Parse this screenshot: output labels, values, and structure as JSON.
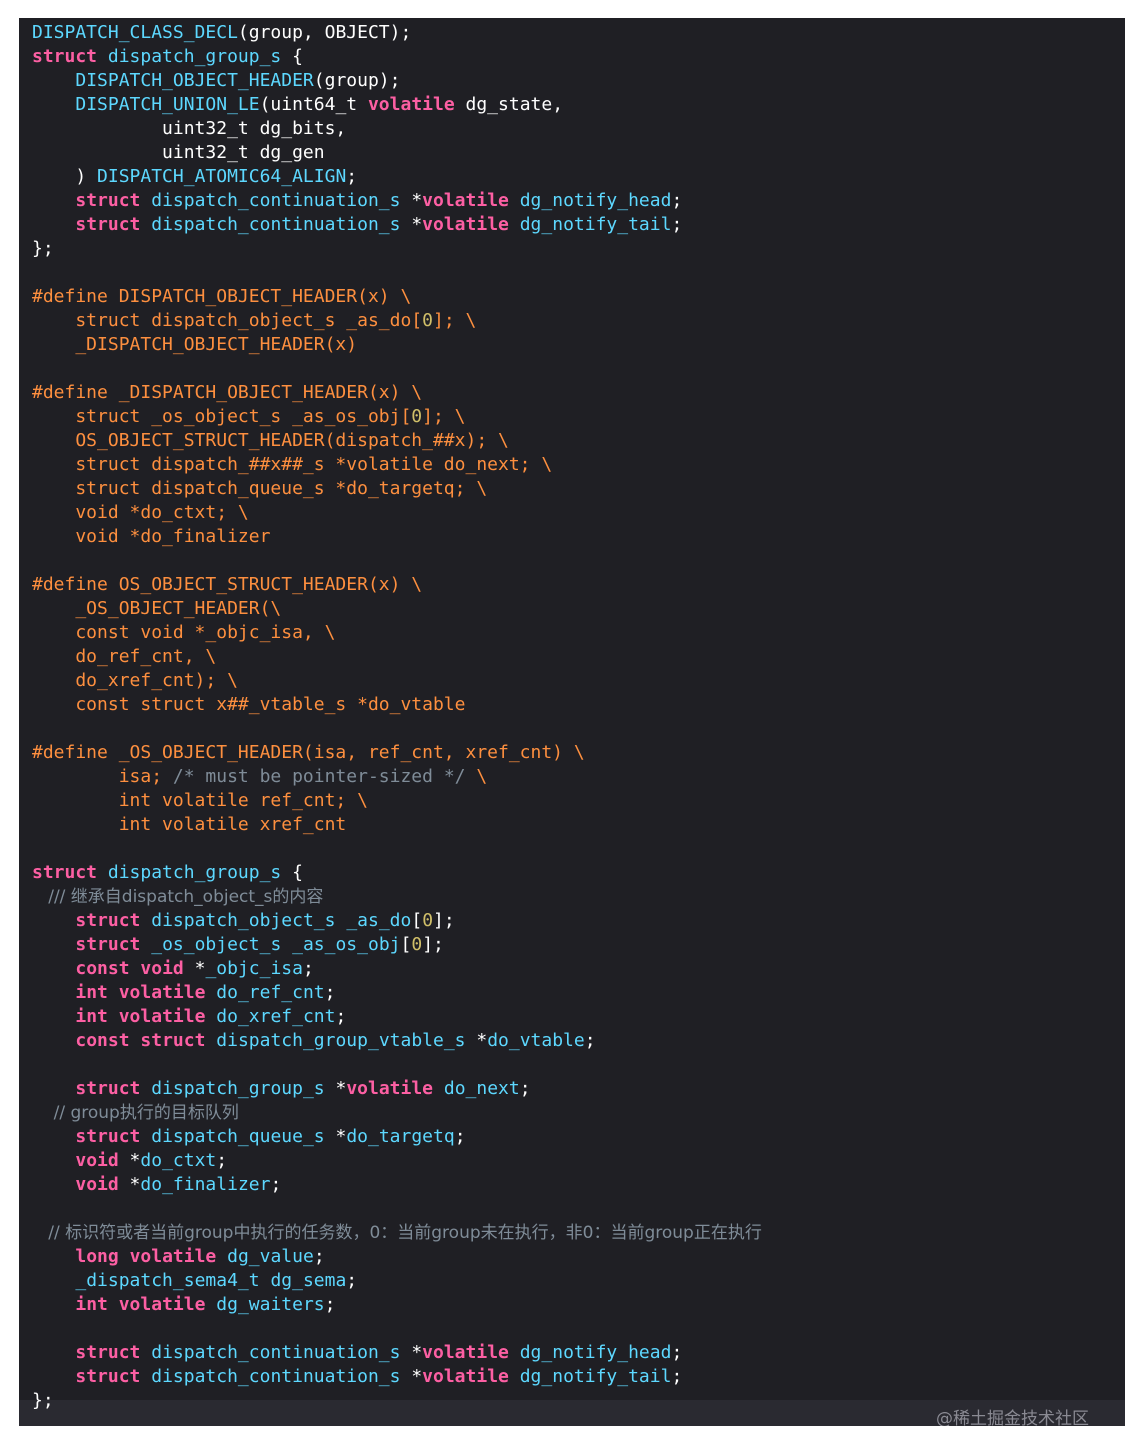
{
  "colors": {
    "background": "#1f1f24",
    "plain": "#ffffff",
    "keyword": "#fc5fa3",
    "type": "#5dd8ff",
    "macro": "#fd8f3f",
    "number": "#d0bf69",
    "comment": "#7f8c98"
  },
  "code_lines": [
    {
      "row": 0,
      "tokens": [
        [
          "DISPATCH_CLASS_DECL",
          "type"
        ],
        [
          "(group, OBJECT);",
          "plain"
        ]
      ]
    },
    {
      "row": 1,
      "tokens": [
        [
          "struct",
          "keyword"
        ],
        [
          " ",
          "plain"
        ],
        [
          "dispatch_group_s",
          "type"
        ],
        [
          " {",
          "plain"
        ]
      ]
    },
    {
      "row": 2,
      "tokens": [
        [
          "    ",
          "plain"
        ],
        [
          "DISPATCH_OBJECT_HEADER",
          "type"
        ],
        [
          "(group);",
          "plain"
        ]
      ]
    },
    {
      "row": 3,
      "tokens": [
        [
          "    ",
          "plain"
        ],
        [
          "DISPATCH_UNION_LE",
          "type"
        ],
        [
          "(uint64_t ",
          "plain"
        ],
        [
          "volatile",
          "keyword"
        ],
        [
          " dg_state,",
          "plain"
        ]
      ]
    },
    {
      "row": 4,
      "tokens": [
        [
          "            uint32_t dg_bits,",
          "plain"
        ]
      ]
    },
    {
      "row": 5,
      "tokens": [
        [
          "            uint32_t dg_gen",
          "plain"
        ]
      ]
    },
    {
      "row": 6,
      "tokens": [
        [
          "    ) ",
          "plain"
        ],
        [
          "DISPATCH_ATOMIC64_ALIGN",
          "type"
        ],
        [
          ";",
          "plain"
        ]
      ]
    },
    {
      "row": 7,
      "tokens": [
        [
          "    ",
          "plain"
        ],
        [
          "struct",
          "keyword"
        ],
        [
          " ",
          "plain"
        ],
        [
          "dispatch_continuation_s",
          "type"
        ],
        [
          " *",
          "plain"
        ],
        [
          "volatile",
          "keyword"
        ],
        [
          " ",
          "plain"
        ],
        [
          "dg_notify_head",
          "type"
        ],
        [
          ";",
          "plain"
        ]
      ]
    },
    {
      "row": 8,
      "tokens": [
        [
          "    ",
          "plain"
        ],
        [
          "struct",
          "keyword"
        ],
        [
          " ",
          "plain"
        ],
        [
          "dispatch_continuation_s",
          "type"
        ],
        [
          " *",
          "plain"
        ],
        [
          "volatile",
          "keyword"
        ],
        [
          " ",
          "plain"
        ],
        [
          "dg_notify_tail",
          "type"
        ],
        [
          ";",
          "plain"
        ]
      ]
    },
    {
      "row": 9,
      "tokens": [
        [
          "};",
          "plain"
        ]
      ]
    },
    {
      "row": 11,
      "tokens": [
        [
          "#define DISPATCH_OBJECT_HEADER(x) \\",
          "macro"
        ]
      ]
    },
    {
      "row": 12,
      "tokens": [
        [
          "    struct dispatch_object_s _as_do[",
          "macro"
        ],
        [
          "0",
          "number"
        ],
        [
          "]; \\",
          "macro"
        ]
      ]
    },
    {
      "row": 13,
      "tokens": [
        [
          "    _DISPATCH_OBJECT_HEADER(x)",
          "macro"
        ]
      ]
    },
    {
      "row": 15,
      "tokens": [
        [
          "#define _DISPATCH_OBJECT_HEADER(x) \\",
          "macro"
        ]
      ]
    },
    {
      "row": 16,
      "tokens": [
        [
          "    struct _os_object_s _as_os_obj[",
          "macro"
        ],
        [
          "0",
          "number"
        ],
        [
          "]; \\",
          "macro"
        ]
      ]
    },
    {
      "row": 17,
      "tokens": [
        [
          "    OS_OBJECT_STRUCT_HEADER(dispatch_##x); \\",
          "macro"
        ]
      ]
    },
    {
      "row": 18,
      "tokens": [
        [
          "    struct dispatch_##x##_s *volatile do_next; \\",
          "macro"
        ]
      ]
    },
    {
      "row": 19,
      "tokens": [
        [
          "    struct dispatch_queue_s *do_targetq; \\",
          "macro"
        ]
      ]
    },
    {
      "row": 20,
      "tokens": [
        [
          "    void *do_ctxt; \\",
          "macro"
        ]
      ]
    },
    {
      "row": 21,
      "tokens": [
        [
          "    void *do_finalizer",
          "macro"
        ]
      ]
    },
    {
      "row": 23,
      "tokens": [
        [
          "#define OS_OBJECT_STRUCT_HEADER(x) \\",
          "macro"
        ]
      ]
    },
    {
      "row": 24,
      "tokens": [
        [
          "    _OS_OBJECT_HEADER(\\",
          "macro"
        ]
      ]
    },
    {
      "row": 25,
      "tokens": [
        [
          "    const void *_objc_isa, \\",
          "macro"
        ]
      ]
    },
    {
      "row": 26,
      "tokens": [
        [
          "    do_ref_cnt, \\",
          "macro"
        ]
      ]
    },
    {
      "row": 27,
      "tokens": [
        [
          "    do_xref_cnt); \\",
          "macro"
        ]
      ]
    },
    {
      "row": 28,
      "tokens": [
        [
          "    const struct x##_vtable_s *do_vtable",
          "macro"
        ]
      ]
    },
    {
      "row": 30,
      "tokens": [
        [
          "#define _OS_OBJECT_HEADER(isa, ref_cnt, xref_cnt) \\",
          "macro"
        ]
      ]
    },
    {
      "row": 31,
      "tokens": [
        [
          "        isa; ",
          "macro"
        ],
        [
          "/* must be pointer-sized */",
          "comment"
        ],
        [
          " \\",
          "macro"
        ]
      ]
    },
    {
      "row": 32,
      "tokens": [
        [
          "        int volatile ref_cnt; \\",
          "macro"
        ]
      ]
    },
    {
      "row": 33,
      "tokens": [
        [
          "        int volatile xref_cnt",
          "macro"
        ]
      ]
    },
    {
      "row": 35,
      "tokens": [
        [
          "struct",
          "keyword"
        ],
        [
          " ",
          "plain"
        ],
        [
          "dispatch_group_s",
          "type"
        ],
        [
          " {",
          "plain"
        ]
      ]
    },
    {
      "row": 36,
      "tokens": [
        [
          "   /// 继承自dispatch_object_s的内容",
          "comment"
        ]
      ]
    },
    {
      "row": 37,
      "tokens": [
        [
          "    ",
          "plain"
        ],
        [
          "struct",
          "keyword"
        ],
        [
          " ",
          "plain"
        ],
        [
          "dispatch_object_s",
          "type"
        ],
        [
          " ",
          "plain"
        ],
        [
          "_as_do",
          "type"
        ],
        [
          "[",
          "plain"
        ],
        [
          "0",
          "number"
        ],
        [
          "];",
          "plain"
        ]
      ]
    },
    {
      "row": 38,
      "tokens": [
        [
          "    ",
          "plain"
        ],
        [
          "struct",
          "keyword"
        ],
        [
          " ",
          "plain"
        ],
        [
          "_os_object_s",
          "type"
        ],
        [
          " ",
          "plain"
        ],
        [
          "_as_os_obj",
          "type"
        ],
        [
          "[",
          "plain"
        ],
        [
          "0",
          "number"
        ],
        [
          "];",
          "plain"
        ]
      ]
    },
    {
      "row": 39,
      "tokens": [
        [
          "    ",
          "plain"
        ],
        [
          "const",
          "keyword"
        ],
        [
          " ",
          "plain"
        ],
        [
          "void",
          "keyword"
        ],
        [
          " *",
          "plain"
        ],
        [
          "_objc_isa",
          "type"
        ],
        [
          ";",
          "plain"
        ]
      ]
    },
    {
      "row": 40,
      "tokens": [
        [
          "    ",
          "plain"
        ],
        [
          "int",
          "keyword"
        ],
        [
          " ",
          "plain"
        ],
        [
          "volatile",
          "keyword"
        ],
        [
          " ",
          "plain"
        ],
        [
          "do_ref_cnt",
          "type"
        ],
        [
          ";",
          "plain"
        ]
      ]
    },
    {
      "row": 41,
      "tokens": [
        [
          "    ",
          "plain"
        ],
        [
          "int",
          "keyword"
        ],
        [
          " ",
          "plain"
        ],
        [
          "volatile",
          "keyword"
        ],
        [
          " ",
          "plain"
        ],
        [
          "do_xref_cnt",
          "type"
        ],
        [
          ";",
          "plain"
        ]
      ]
    },
    {
      "row": 42,
      "tokens": [
        [
          "    ",
          "plain"
        ],
        [
          "const",
          "keyword"
        ],
        [
          " ",
          "plain"
        ],
        [
          "struct",
          "keyword"
        ],
        [
          " ",
          "plain"
        ],
        [
          "dispatch_group_vtable_s",
          "type"
        ],
        [
          " *",
          "plain"
        ],
        [
          "do_vtable",
          "type"
        ],
        [
          ";",
          "plain"
        ]
      ]
    },
    {
      "row": 44,
      "tokens": [
        [
          "    ",
          "plain"
        ],
        [
          "struct",
          "keyword"
        ],
        [
          " ",
          "plain"
        ],
        [
          "dispatch_group_s",
          "type"
        ],
        [
          " *",
          "plain"
        ],
        [
          "volatile",
          "keyword"
        ],
        [
          " ",
          "plain"
        ],
        [
          "do_next",
          "type"
        ],
        [
          ";",
          "plain"
        ]
      ]
    },
    {
      "row": 45,
      "tokens": [
        [
          "    // group执行的目标队列",
          "comment"
        ]
      ]
    },
    {
      "row": 46,
      "tokens": [
        [
          "    ",
          "plain"
        ],
        [
          "struct",
          "keyword"
        ],
        [
          " ",
          "plain"
        ],
        [
          "dispatch_queue_s",
          "type"
        ],
        [
          " *",
          "plain"
        ],
        [
          "do_targetq",
          "type"
        ],
        [
          ";",
          "plain"
        ]
      ]
    },
    {
      "row": 47,
      "tokens": [
        [
          "    ",
          "plain"
        ],
        [
          "void",
          "keyword"
        ],
        [
          " *",
          "plain"
        ],
        [
          "do_ctxt",
          "type"
        ],
        [
          ";",
          "plain"
        ]
      ]
    },
    {
      "row": 48,
      "tokens": [
        [
          "    ",
          "plain"
        ],
        [
          "void",
          "keyword"
        ],
        [
          " *",
          "plain"
        ],
        [
          "do_finalizer",
          "type"
        ],
        [
          ";",
          "plain"
        ]
      ]
    },
    {
      "row": 50,
      "tokens": [
        [
          "   // 标识符或者当前group中执行的任务数，0：当前group未在执行，非0：当前group正在执行",
          "comment"
        ]
      ]
    },
    {
      "row": 51,
      "tokens": [
        [
          "    ",
          "plain"
        ],
        [
          "long",
          "keyword"
        ],
        [
          " ",
          "plain"
        ],
        [
          "volatile",
          "keyword"
        ],
        [
          " ",
          "plain"
        ],
        [
          "dg_value",
          "type"
        ],
        [
          ";",
          "plain"
        ]
      ]
    },
    {
      "row": 52,
      "tokens": [
        [
          "    ",
          "plain"
        ],
        [
          "_dispatch_sema4_t",
          "type"
        ],
        [
          " ",
          "plain"
        ],
        [
          "dg_sema",
          "type"
        ],
        [
          ";",
          "plain"
        ]
      ]
    },
    {
      "row": 53,
      "tokens": [
        [
          "    ",
          "plain"
        ],
        [
          "int",
          "keyword"
        ],
        [
          " ",
          "plain"
        ],
        [
          "volatile",
          "keyword"
        ],
        [
          " ",
          "plain"
        ],
        [
          "dg_waiters",
          "type"
        ],
        [
          ";",
          "plain"
        ]
      ]
    },
    {
      "row": 55,
      "tokens": [
        [
          "    ",
          "plain"
        ],
        [
          "struct",
          "keyword"
        ],
        [
          " ",
          "plain"
        ],
        [
          "dispatch_continuation_s",
          "type"
        ],
        [
          " *",
          "plain"
        ],
        [
          "volatile",
          "keyword"
        ],
        [
          " ",
          "plain"
        ],
        [
          "dg_notify_head",
          "type"
        ],
        [
          ";",
          "plain"
        ]
      ]
    },
    {
      "row": 56,
      "tokens": [
        [
          "    ",
          "plain"
        ],
        [
          "struct",
          "keyword"
        ],
        [
          " ",
          "plain"
        ],
        [
          "dispatch_continuation_s",
          "type"
        ],
        [
          " *",
          "plain"
        ],
        [
          "volatile",
          "keyword"
        ],
        [
          " ",
          "plain"
        ],
        [
          "dg_notify_tail",
          "type"
        ],
        [
          ";",
          "plain"
        ]
      ]
    },
    {
      "row": 57,
      "tokens": [
        [
          "};",
          "plain"
        ]
      ]
    }
  ],
  "watermark": "@稀土掘金技术社区"
}
